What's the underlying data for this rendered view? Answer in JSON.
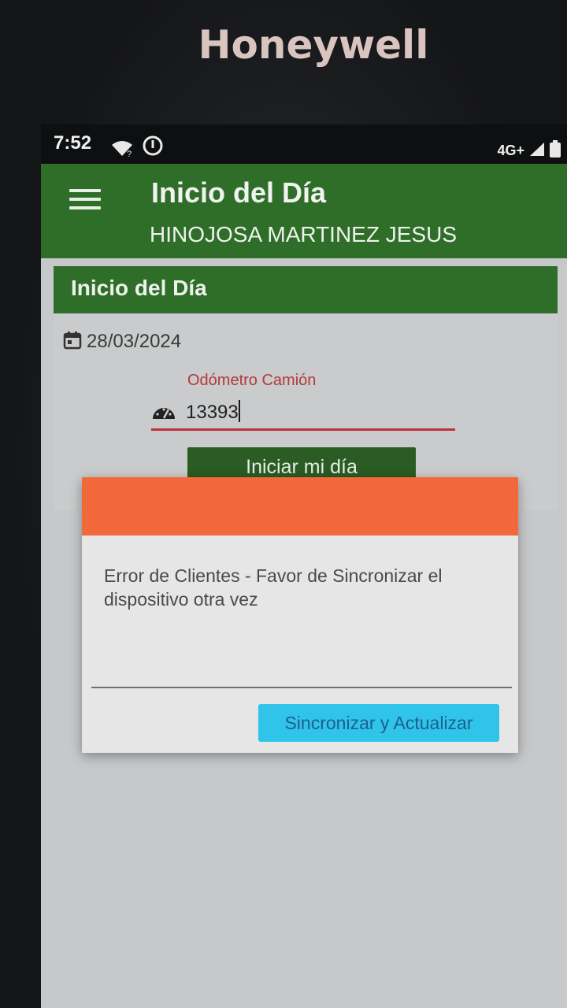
{
  "device": {
    "brand": "Honeywell"
  },
  "status_bar": {
    "time": "7:52",
    "network_label": "4G+",
    "icons": [
      "wifi-question-icon",
      "alert-circle-icon",
      "signal-icon",
      "battery-icon"
    ]
  },
  "app_bar": {
    "title": "Inicio del Día",
    "subtitle": "HINOJOSA MARTINEZ JESUS",
    "menu_icon": "hamburger-menu-icon"
  },
  "card": {
    "title": "Inicio del Día",
    "date_icon": "calendar-icon",
    "date": "28/03/2024",
    "odometer": {
      "label": "Odómetro Camión",
      "icon": "speedometer-icon",
      "value": "13393"
    },
    "start_button_label": "Iniciar mi día"
  },
  "dialog": {
    "message": "Error de Clientes - Favor de Sincronizar el dispositivo otra vez",
    "button_label": "Sincronizar y Actualizar"
  },
  "colors": {
    "primary_green": "#2f6e28",
    "dialog_header": "#f2683a",
    "dialog_button": "#30c4ea",
    "error_red": "#c0303a"
  }
}
